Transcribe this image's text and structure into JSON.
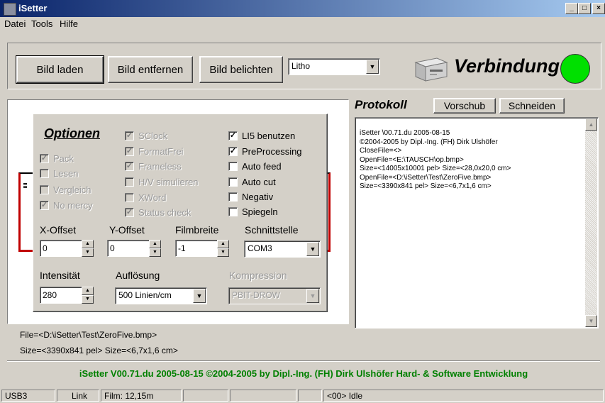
{
  "window": {
    "title": "iSetter",
    "controls": [
      "_",
      "□",
      "×"
    ]
  },
  "menu": [
    "Datei",
    "Tools",
    "Hilfe"
  ],
  "toolbar": {
    "load_label": "Bild laden",
    "remove_label": "Bild entfernen",
    "expose_label": "Bild belichten",
    "mode_value": "Litho",
    "connection_label": "Verbindung",
    "connection_color": "#00e000"
  },
  "options": {
    "title": "Optionen",
    "left_checks": [
      {
        "label": "Pack",
        "checked": true
      },
      {
        "label": "Lesen",
        "checked": false
      },
      {
        "label": "Vergleich",
        "checked": false
      },
      {
        "label": "No mercy",
        "checked": true
      }
    ],
    "mid_checks": [
      {
        "label": "SClock",
        "checked": true
      },
      {
        "label": "FormatFrei",
        "checked": true
      },
      {
        "label": "Frameless",
        "checked": true
      },
      {
        "label": "H/V simulieren",
        "checked": false
      },
      {
        "label": "XWord",
        "checked": false
      },
      {
        "label": "Status check",
        "checked": true
      }
    ],
    "right_checks": [
      {
        "label": "LI5 benutzen",
        "checked": true
      },
      {
        "label": "PreProcessing",
        "checked": true
      },
      {
        "label": "Auto feed",
        "checked": false
      },
      {
        "label": "Auto cut",
        "checked": false
      },
      {
        "label": "Negativ",
        "checked": false
      },
      {
        "label": "Spiegeln",
        "checked": false
      }
    ],
    "x_offset_label": "X-Offset",
    "x_offset_value": "0",
    "y_offset_label": "Y-Offset",
    "y_offset_value": "0",
    "film_width_label": "Filmbreite",
    "film_width_value": "-1",
    "interface_label": "Schnittstelle",
    "interface_value": "COM3",
    "intensity_label": "Intensität",
    "intensity_value": "280",
    "resolution_label": "Auflösung",
    "resolution_value": "500 Linien/cm",
    "compression_label": "Kompression",
    "compression_value": "PBIT-DROW"
  },
  "protocol": {
    "title": "Protokoll",
    "feed_label": "Vorschub",
    "cut_label": "Schneiden",
    "lines": [
      "iSetter \\00.71.du 2005-08-15",
      "©2004-2005 by Dipl.-Ing. (FH) Dirk Ulshöfer",
      "CloseFile=<>",
      "OpenFile=<E:\\TAUSCH\\op.bmp>",
      "Size=<14005x10001 pel> Size=<28,0x20,0 cm>",
      "OpenFile=<D:\\iSetter\\Test\\ZeroFive.bmp>",
      "Size=<3390x841 pel> Size=<6,7x1,6 cm>"
    ]
  },
  "file_info": {
    "line1": "File=<D:\\iSetter\\Test\\ZeroFive.bmp>",
    "line2": "Size=<3390x841 pel> Size=<6,7x1,6 cm>"
  },
  "footer_banner": "iSetter V00.71.du 2005-08-15 ©2004-2005 by Dipl.-Ing. (FH) Dirk Ulshöfer Hard- & Software Entwicklung",
  "statusbar": {
    "port": "USB3",
    "link": "Link",
    "film": "Film: 12,15m",
    "state": "<00> Idle"
  }
}
